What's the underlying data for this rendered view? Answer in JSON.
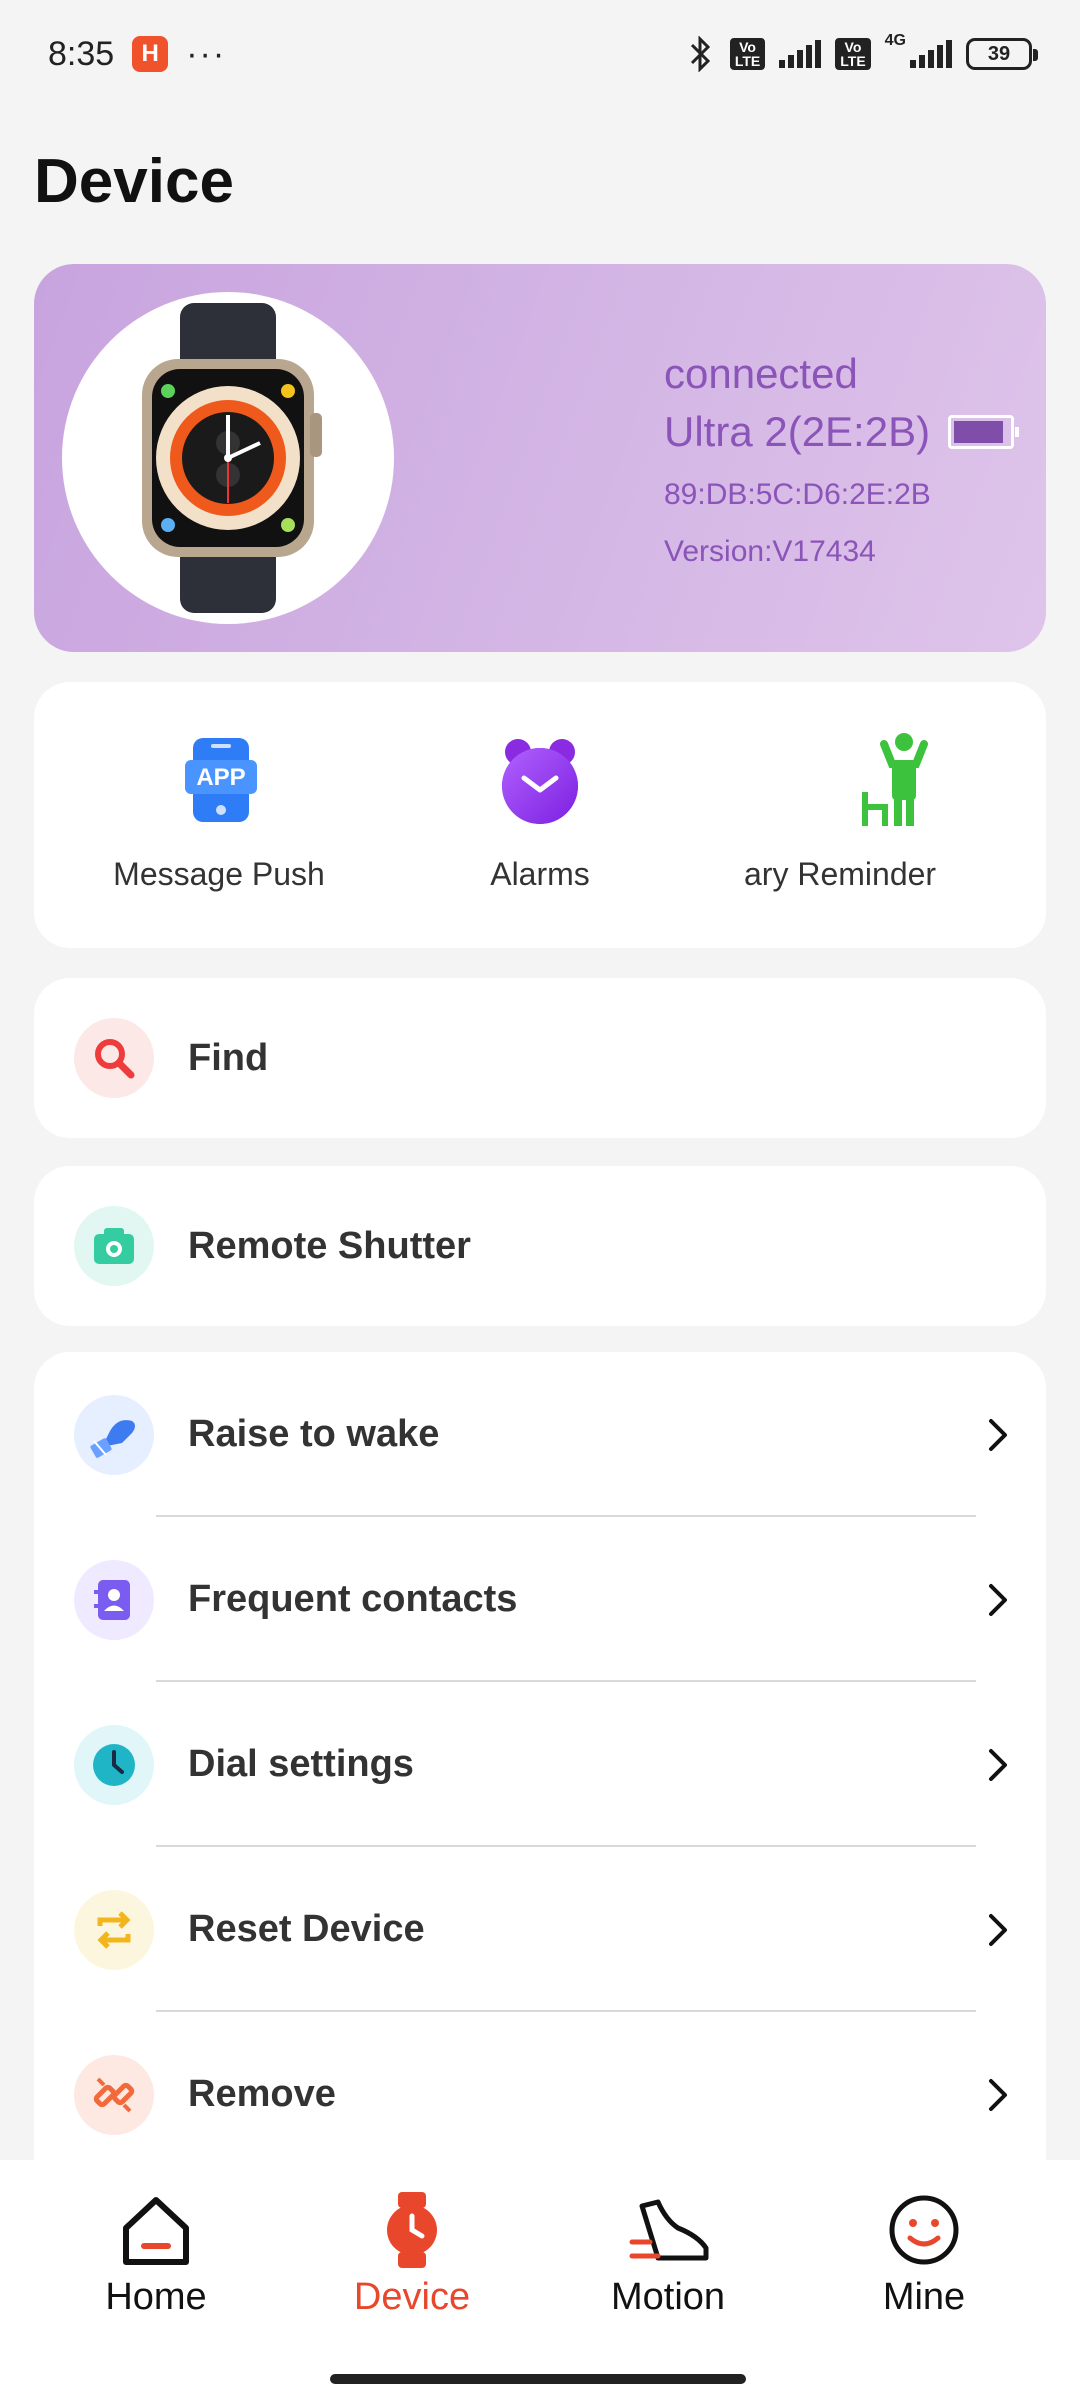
{
  "status_bar": {
    "time": "8:35",
    "app_badge": "H",
    "more": "···",
    "network": "4G",
    "battery": "39"
  },
  "page": {
    "title": "Device"
  },
  "device": {
    "status": "connected",
    "name": "Ultra 2(2E:2B)",
    "mac": "89:DB:5C:D6:2E:2B",
    "version": "Version:V17434",
    "battery_level": 0.9
  },
  "quick_actions": [
    {
      "label": "Message Push",
      "icon": "app-notification-icon",
      "badge": "APP"
    },
    {
      "label": "Alarms",
      "icon": "alarm-clock-icon"
    },
    {
      "label": "ary Reminder",
      "icon": "sedentary-reminder-icon"
    }
  ],
  "find": {
    "label": "Find",
    "icon": "search-icon"
  },
  "remote_shutter": {
    "label": "Remote Shutter",
    "icon": "camera-icon"
  },
  "settings": [
    {
      "label": "Raise to wake",
      "icon": "raise-wrist-icon"
    },
    {
      "label": "Frequent contacts",
      "icon": "contacts-icon"
    },
    {
      "label": "Dial settings",
      "icon": "clock-icon"
    },
    {
      "label": "Reset Device",
      "icon": "reset-icon"
    },
    {
      "label": "Remove",
      "icon": "unlink-icon"
    }
  ],
  "nav": [
    {
      "label": "Home",
      "icon": "home-icon"
    },
    {
      "label": "Device",
      "icon": "watch-icon",
      "active": true
    },
    {
      "label": "Motion",
      "icon": "shoe-icon"
    },
    {
      "label": "Mine",
      "icon": "smiley-icon"
    }
  ],
  "colors": {
    "accent": "#e8472b",
    "device_card": "#c8a4df",
    "device_text": "#8a54b8"
  }
}
